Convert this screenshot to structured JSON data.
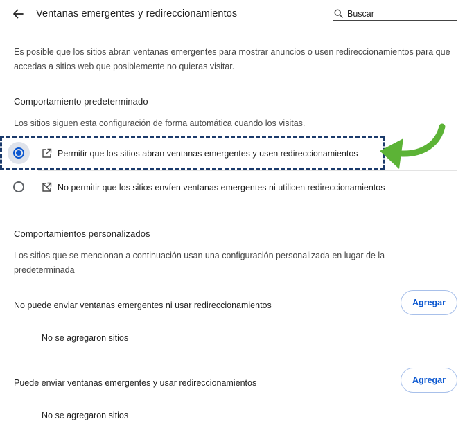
{
  "header": {
    "title": "Ventanas emergentes y redireccionamientos",
    "search_placeholder": "Buscar"
  },
  "intro": "Es posible que los sitios abran ventanas emergentes para mostrar anuncios o usen redireccionamientos para que accedas a sitios web que posiblemente no quieras visitar.",
  "default_behavior": {
    "title": "Comportamiento predeterminado",
    "description": "Los sitios siguen esta configuración de forma automática cuando los visitas.",
    "options": [
      {
        "label": "Permitir que los sitios abran ventanas emergentes y usen redireccionamientos",
        "icon": "open-in-new-icon",
        "selected": true
      },
      {
        "label": "No permitir que los sitios envíen ventanas emergentes ni utilicen redireccionamientos",
        "icon": "popups-blocked-icon",
        "selected": false
      }
    ]
  },
  "custom_behaviors": {
    "title": "Comportamientos personalizados",
    "description": "Los sitios que se mencionan a continuación usan una configuración personalizada en lugar de la predeterminada",
    "lists": [
      {
        "label": "No puede enviar ventanas emergentes ni usar redireccionamientos",
        "button": "Agregar",
        "empty": "No se agregaron sitios"
      },
      {
        "label": "Puede enviar ventanas emergentes y usar redireccionamientos",
        "button": "Agregar",
        "empty": "No se agregaron sitios"
      }
    ]
  },
  "colors": {
    "accent": "#0b57d0",
    "annotation_arrow": "#5cb336",
    "annotation_box": "#1b3a6b"
  }
}
